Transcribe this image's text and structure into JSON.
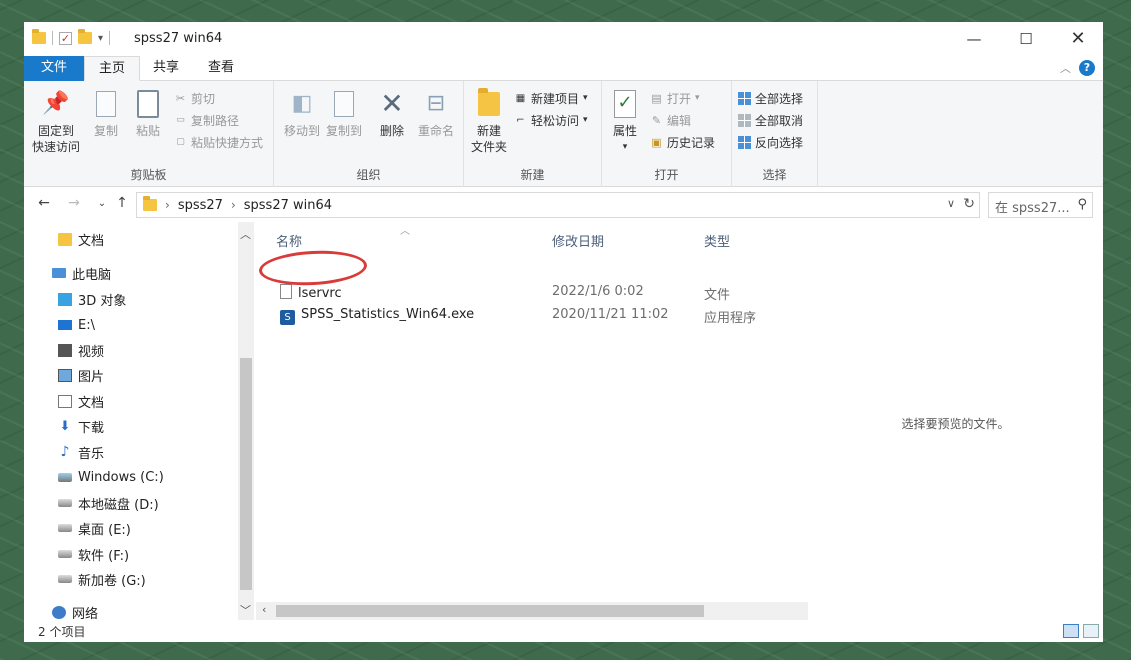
{
  "window": {
    "title": "spss27 win64",
    "min": "—",
    "max": "☐",
    "close": "✕"
  },
  "tabs": {
    "file": "文件",
    "home": "主页",
    "share": "共享",
    "view": "查看"
  },
  "ribbon": {
    "clipboard": {
      "pin": "固定到",
      "pin2": "快速访问",
      "copy": "复制",
      "paste": "粘贴",
      "cut": "剪切",
      "copy_path": "复制路径",
      "paste_shortcut": "粘贴快捷方式",
      "group": "剪贴板"
    },
    "organize": {
      "move_to": "移动到",
      "copy_to": "复制到",
      "delete": "删除",
      "rename": "重命名",
      "group": "组织"
    },
    "new": {
      "new_folder": "新建",
      "new_folder2": "文件夹",
      "new_item": "新建项目",
      "easy_access": "轻松访问",
      "group": "新建"
    },
    "open": {
      "properties": "属性",
      "open": "打开",
      "edit": "编辑",
      "history": "历史记录",
      "group": "打开"
    },
    "select": {
      "select_all": "全部选择",
      "select_none": "全部取消",
      "invert": "反向选择",
      "group": "选择"
    }
  },
  "address": {
    "crumbs": [
      "spss27",
      "spss27 win64"
    ],
    "search_placeholder": "在 spss27..."
  },
  "nav": {
    "items": [
      "文档",
      "此电脑",
      "3D 对象",
      "E:\\",
      "视频",
      "图片",
      "文档",
      "下载",
      "音乐",
      "Windows (C:)",
      "本地磁盘 (D:)",
      "桌面 (E:)",
      "软件 (F:)",
      "新加卷 (G:)",
      "网络"
    ]
  },
  "filelist": {
    "columns": {
      "name": "名称",
      "date": "修改日期",
      "type": "类型"
    },
    "rows": [
      {
        "name": "lservrc",
        "date": "2022/1/6 0:02",
        "type": "文件"
      },
      {
        "name": "SPSS_Statistics_Win64.exe",
        "date": "2020/11/21 11:02",
        "type": "应用程序"
      }
    ]
  },
  "preview": {
    "message": "选择要预览的文件。"
  },
  "status": {
    "count": "2 个项目"
  }
}
